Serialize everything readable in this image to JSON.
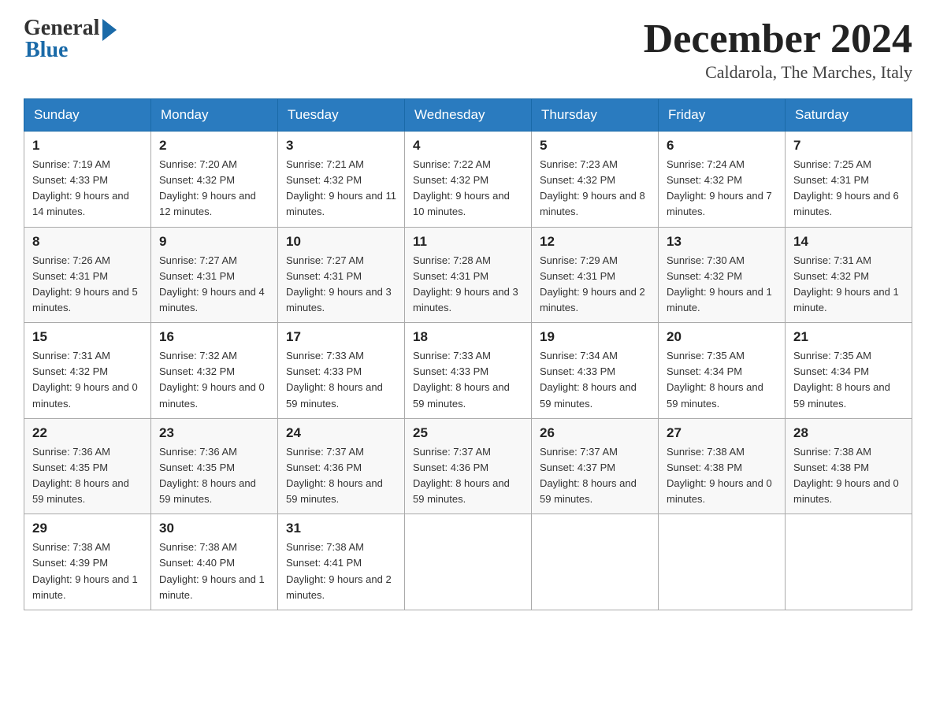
{
  "header": {
    "logo_general": "General",
    "logo_blue": "Blue",
    "month_title": "December 2024",
    "location": "Caldarola, The Marches, Italy"
  },
  "days_of_week": [
    "Sunday",
    "Monday",
    "Tuesday",
    "Wednesday",
    "Thursday",
    "Friday",
    "Saturday"
  ],
  "weeks": [
    [
      {
        "day": "1",
        "sunrise": "7:19 AM",
        "sunset": "4:33 PM",
        "daylight": "9 hours and 14 minutes."
      },
      {
        "day": "2",
        "sunrise": "7:20 AM",
        "sunset": "4:32 PM",
        "daylight": "9 hours and 12 minutes."
      },
      {
        "day": "3",
        "sunrise": "7:21 AM",
        "sunset": "4:32 PM",
        "daylight": "9 hours and 11 minutes."
      },
      {
        "day": "4",
        "sunrise": "7:22 AM",
        "sunset": "4:32 PM",
        "daylight": "9 hours and 10 minutes."
      },
      {
        "day": "5",
        "sunrise": "7:23 AM",
        "sunset": "4:32 PM",
        "daylight": "9 hours and 8 minutes."
      },
      {
        "day": "6",
        "sunrise": "7:24 AM",
        "sunset": "4:32 PM",
        "daylight": "9 hours and 7 minutes."
      },
      {
        "day": "7",
        "sunrise": "7:25 AM",
        "sunset": "4:31 PM",
        "daylight": "9 hours and 6 minutes."
      }
    ],
    [
      {
        "day": "8",
        "sunrise": "7:26 AM",
        "sunset": "4:31 PM",
        "daylight": "9 hours and 5 minutes."
      },
      {
        "day": "9",
        "sunrise": "7:27 AM",
        "sunset": "4:31 PM",
        "daylight": "9 hours and 4 minutes."
      },
      {
        "day": "10",
        "sunrise": "7:27 AM",
        "sunset": "4:31 PM",
        "daylight": "9 hours and 3 minutes."
      },
      {
        "day": "11",
        "sunrise": "7:28 AM",
        "sunset": "4:31 PM",
        "daylight": "9 hours and 3 minutes."
      },
      {
        "day": "12",
        "sunrise": "7:29 AM",
        "sunset": "4:31 PM",
        "daylight": "9 hours and 2 minutes."
      },
      {
        "day": "13",
        "sunrise": "7:30 AM",
        "sunset": "4:32 PM",
        "daylight": "9 hours and 1 minute."
      },
      {
        "day": "14",
        "sunrise": "7:31 AM",
        "sunset": "4:32 PM",
        "daylight": "9 hours and 1 minute."
      }
    ],
    [
      {
        "day": "15",
        "sunrise": "7:31 AM",
        "sunset": "4:32 PM",
        "daylight": "9 hours and 0 minutes."
      },
      {
        "day": "16",
        "sunrise": "7:32 AM",
        "sunset": "4:32 PM",
        "daylight": "9 hours and 0 minutes."
      },
      {
        "day": "17",
        "sunrise": "7:33 AM",
        "sunset": "4:33 PM",
        "daylight": "8 hours and 59 minutes."
      },
      {
        "day": "18",
        "sunrise": "7:33 AM",
        "sunset": "4:33 PM",
        "daylight": "8 hours and 59 minutes."
      },
      {
        "day": "19",
        "sunrise": "7:34 AM",
        "sunset": "4:33 PM",
        "daylight": "8 hours and 59 minutes."
      },
      {
        "day": "20",
        "sunrise": "7:35 AM",
        "sunset": "4:34 PM",
        "daylight": "8 hours and 59 minutes."
      },
      {
        "day": "21",
        "sunrise": "7:35 AM",
        "sunset": "4:34 PM",
        "daylight": "8 hours and 59 minutes."
      }
    ],
    [
      {
        "day": "22",
        "sunrise": "7:36 AM",
        "sunset": "4:35 PM",
        "daylight": "8 hours and 59 minutes."
      },
      {
        "day": "23",
        "sunrise": "7:36 AM",
        "sunset": "4:35 PM",
        "daylight": "8 hours and 59 minutes."
      },
      {
        "day": "24",
        "sunrise": "7:37 AM",
        "sunset": "4:36 PM",
        "daylight": "8 hours and 59 minutes."
      },
      {
        "day": "25",
        "sunrise": "7:37 AM",
        "sunset": "4:36 PM",
        "daylight": "8 hours and 59 minutes."
      },
      {
        "day": "26",
        "sunrise": "7:37 AM",
        "sunset": "4:37 PM",
        "daylight": "8 hours and 59 minutes."
      },
      {
        "day": "27",
        "sunrise": "7:38 AM",
        "sunset": "4:38 PM",
        "daylight": "9 hours and 0 minutes."
      },
      {
        "day": "28",
        "sunrise": "7:38 AM",
        "sunset": "4:38 PM",
        "daylight": "9 hours and 0 minutes."
      }
    ],
    [
      {
        "day": "29",
        "sunrise": "7:38 AM",
        "sunset": "4:39 PM",
        "daylight": "9 hours and 1 minute."
      },
      {
        "day": "30",
        "sunrise": "7:38 AM",
        "sunset": "4:40 PM",
        "daylight": "9 hours and 1 minute."
      },
      {
        "day": "31",
        "sunrise": "7:38 AM",
        "sunset": "4:41 PM",
        "daylight": "9 hours and 2 minutes."
      },
      null,
      null,
      null,
      null
    ]
  ]
}
